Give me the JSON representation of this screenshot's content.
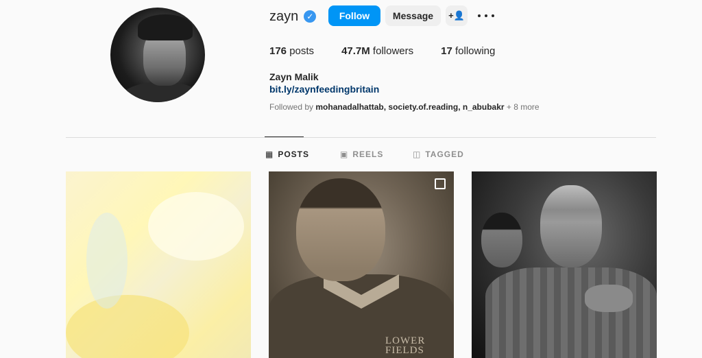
{
  "profile": {
    "username": "zayn",
    "verified_icon": "verified-badge-icon",
    "full_name": "Zayn Malik",
    "link": "bit.ly/zaynfeedingbritain",
    "followed_by_prefix": "Followed by ",
    "followed_by_names": "mohanadalhattab, society.of.reading, n_abubakr",
    "followed_by_more": " + 8 more"
  },
  "actions": {
    "follow_label": "Follow",
    "message_label": "Message",
    "add_user_icon": "+👤",
    "more_icon": "more-horizontal-icon"
  },
  "stats": [
    {
      "value": "176",
      "label": " posts"
    },
    {
      "value": "47.7M",
      "label": " followers"
    },
    {
      "value": "17",
      "label": " following"
    }
  ],
  "tabs": [
    {
      "label": "POSTS",
      "icon": "▦",
      "active": true
    },
    {
      "label": "REELS",
      "icon": "▣",
      "active": false
    },
    {
      "label": "TAGGED",
      "icon": "◫",
      "active": false
    }
  ],
  "posts": {
    "post2_caption_text": "LOWER\nFIELDS"
  },
  "colors": {
    "accent": "#0095f6",
    "verified": "#3897f0",
    "link": "#00376b",
    "background": "#fafafa"
  }
}
